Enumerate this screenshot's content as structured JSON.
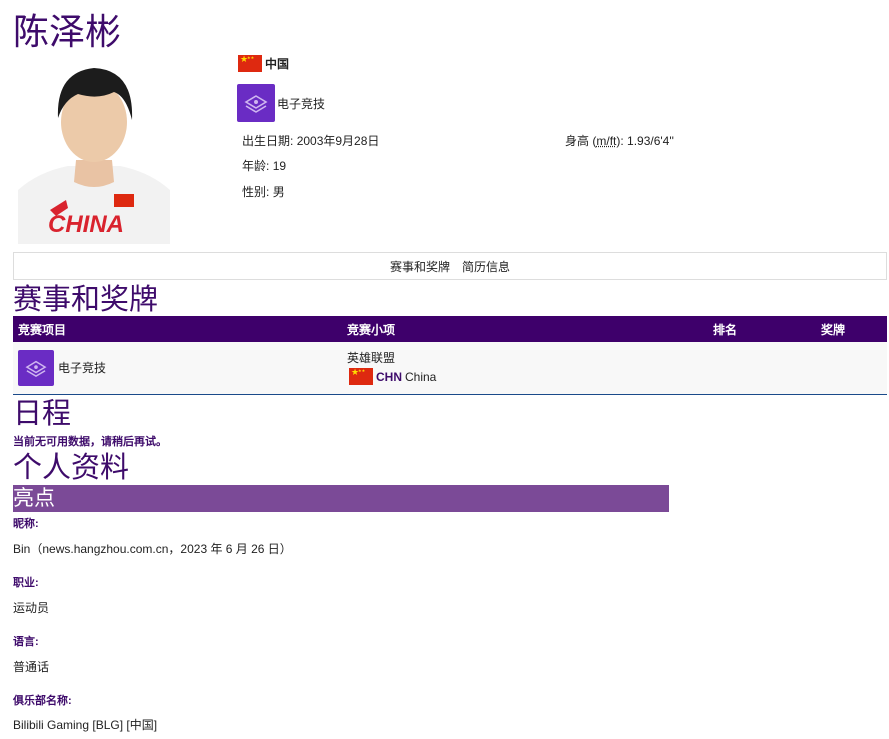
{
  "athlete": {
    "name": "陈泽彬",
    "country": "中国",
    "sport": "电子竞技",
    "birth_label": "出生日期:",
    "birth_value": "2003年9月28日",
    "age_label": "年龄:",
    "age_value": "19",
    "gender_label": "性别:",
    "gender_value": "男",
    "height_label": "身高",
    "height_units": "m/ft",
    "height_value": "1.93/6'4''"
  },
  "subnav": {
    "items": [
      "赛事和奖牌",
      "简历信息"
    ]
  },
  "sections": {
    "events_title": "赛事和奖牌",
    "schedule_title": "日程",
    "schedule_empty": "当前无可用数据，请稍后再试。",
    "profile_title": "个人资料",
    "highlights_title": "亮点"
  },
  "results_table": {
    "headers": [
      "竞赛项目",
      "竞赛小项",
      "排名",
      "奖牌"
    ],
    "rows": [
      {
        "sport": "电子竞技",
        "event": "英雄联盟",
        "noc_code": "CHN",
        "noc_name": "China",
        "rank": "",
        "medal": ""
      }
    ]
  },
  "profile": [
    {
      "label": "昵称:",
      "value": "Bin（news.hangzhou.com.cn，2023 年 6 月 26 日）"
    },
    {
      "label": "职业:",
      "value": "运动员"
    },
    {
      "label": "语言:",
      "value": "普通话"
    },
    {
      "label": "俱乐部名称:",
      "value": "Bilibili Gaming [BLG] [中国]"
    }
  ],
  "colors": {
    "brand_purple": "#3e006b",
    "highlight_purple": "#7b4a97",
    "sport_icon": "#6a2cc4",
    "flag_red": "#de2910"
  }
}
